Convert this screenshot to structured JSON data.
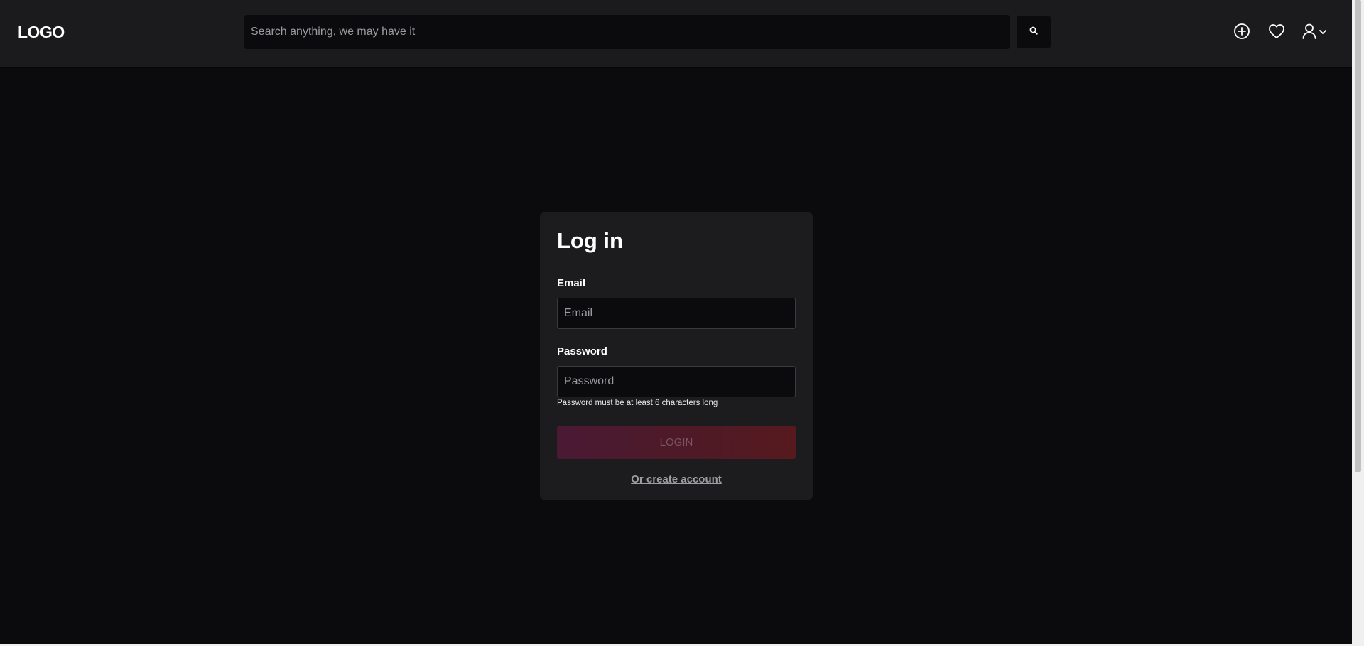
{
  "header": {
    "logo": "LOGO",
    "search": {
      "placeholder": "Search anything, we may have it",
      "value": ""
    },
    "icons": [
      "search-icon",
      "plus-circle-icon",
      "heart-icon",
      "user-icon",
      "chevron-down-icon"
    ]
  },
  "login": {
    "title": "Log in",
    "email_label": "Email",
    "email_placeholder": "Email",
    "password_label": "Password",
    "password_placeholder": "Password",
    "password_hint": "Password must be at least 6 characters long",
    "login_button": "LOGIN",
    "create_account_link": "Or create account"
  },
  "colors": {
    "page_background": "#0b0b0d",
    "header_background": "#1b1b1d",
    "card_background": "#1c1c1e",
    "button_gradient_start": "#4a1a34",
    "button_gradient_end": "#561a1e"
  }
}
